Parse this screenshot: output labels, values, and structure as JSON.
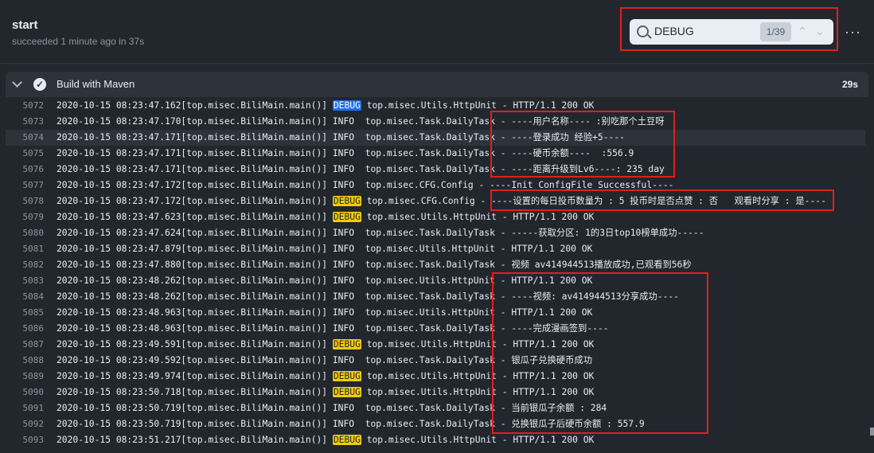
{
  "job": {
    "title": "start",
    "subtitle": "succeeded 1 minute ago in 37s"
  },
  "search": {
    "query": "DEBUG",
    "count": "1/39",
    "prev_icon": "chevron-up",
    "next_icon": "chevron-down"
  },
  "menu": {
    "more_label": "···"
  },
  "step": {
    "title": "Build with Maven",
    "duration": "29s",
    "status_icon": "check-circle"
  },
  "log": {
    "search_term": "DEBUG",
    "lines": [
      {
        "n": "5072",
        "ts": "2020-10-15 08:23:47.162[top.misec.BiliMain.main()]",
        "level": "DEBUG",
        "src": "top.misec.Utils.HttpUnit",
        "msg": "- HTTP/1.1 200 OK",
        "current": true
      },
      {
        "n": "5073",
        "ts": "2020-10-15 08:23:47.170[top.misec.BiliMain.main()]",
        "level": "INFO",
        "src": "top.misec.Task.DailyTask",
        "msg": "- ----用户名称---- :别吃那个土豆呀"
      },
      {
        "n": "5074",
        "ts": "2020-10-15 08:23:47.171[top.misec.BiliMain.main()]",
        "level": "INFO",
        "src": "top.misec.Task.DailyTask",
        "msg": "- ----登录成功 经验+5----",
        "active": true
      },
      {
        "n": "5075",
        "ts": "2020-10-15 08:23:47.171[top.misec.BiliMain.main()]",
        "level": "INFO",
        "src": "top.misec.Task.DailyTask",
        "msg": "- ----硬币余额----  :556.9"
      },
      {
        "n": "5076",
        "ts": "2020-10-15 08:23:47.171[top.misec.BiliMain.main()]",
        "level": "INFO",
        "src": "top.misec.Task.DailyTask",
        "msg": "- ----距离升级到Lv6----: 235 day"
      },
      {
        "n": "5077",
        "ts": "2020-10-15 08:23:47.172[top.misec.BiliMain.main()]",
        "level": "INFO",
        "src": "top.misec.CFG.Config",
        "msg": "- ----Init ConfigFile Successful----"
      },
      {
        "n": "5078",
        "ts": "2020-10-15 08:23:47.172[top.misec.BiliMain.main()]",
        "level": "DEBUG",
        "src": "top.misec.CFG.Config",
        "msg": "- ----设置的每日投币数量为 : 5 投币时是否点赞 : 否   观看时分享 : 是----"
      },
      {
        "n": "5079",
        "ts": "2020-10-15 08:23:47.623[top.misec.BiliMain.main()]",
        "level": "DEBUG",
        "src": "top.misec.Utils.HttpUnit",
        "msg": "- HTTP/1.1 200 OK"
      },
      {
        "n": "5080",
        "ts": "2020-10-15 08:23:47.624[top.misec.BiliMain.main()]",
        "level": "INFO",
        "src": "top.misec.Task.DailyTask",
        "msg": "- -----获取分区: 1的3日top10榜单成功-----"
      },
      {
        "n": "5081",
        "ts": "2020-10-15 08:23:47.879[top.misec.BiliMain.main()]",
        "level": "INFO",
        "src": "top.misec.Utils.HttpUnit",
        "msg": "- HTTP/1.1 200 OK"
      },
      {
        "n": "5082",
        "ts": "2020-10-15 08:23:47.880[top.misec.BiliMain.main()]",
        "level": "INFO",
        "src": "top.misec.Task.DailyTask",
        "msg": "- 视频 av414944513播放成功,已观看到56秒"
      },
      {
        "n": "5083",
        "ts": "2020-10-15 08:23:48.262[top.misec.BiliMain.main()]",
        "level": "INFO",
        "src": "top.misec.Utils.HttpUnit",
        "msg": "- HTTP/1.1 200 OK"
      },
      {
        "n": "5084",
        "ts": "2020-10-15 08:23:48.262[top.misec.BiliMain.main()]",
        "level": "INFO",
        "src": "top.misec.Task.DailyTask",
        "msg": "- ----视频: av414944513分享成功----"
      },
      {
        "n": "5085",
        "ts": "2020-10-15 08:23:48.963[top.misec.BiliMain.main()]",
        "level": "INFO",
        "src": "top.misec.Utils.HttpUnit",
        "msg": "- HTTP/1.1 200 OK"
      },
      {
        "n": "5086",
        "ts": "2020-10-15 08:23:48.963[top.misec.BiliMain.main()]",
        "level": "INFO",
        "src": "top.misec.Task.DailyTask",
        "msg": "- ----完成漫画签到----"
      },
      {
        "n": "5087",
        "ts": "2020-10-15 08:23:49.591[top.misec.BiliMain.main()]",
        "level": "DEBUG",
        "src": "top.misec.Utils.HttpUnit",
        "msg": "- HTTP/1.1 200 OK"
      },
      {
        "n": "5088",
        "ts": "2020-10-15 08:23:49.592[top.misec.BiliMain.main()]",
        "level": "INFO",
        "src": "top.misec.Task.DailyTask",
        "msg": "- 银瓜子兑换硬币成功"
      },
      {
        "n": "5089",
        "ts": "2020-10-15 08:23:49.974[top.misec.BiliMain.main()]",
        "level": "DEBUG",
        "src": "top.misec.Utils.HttpUnit",
        "msg": "- HTTP/1.1 200 OK"
      },
      {
        "n": "5090",
        "ts": "2020-10-15 08:23:50.718[top.misec.BiliMain.main()]",
        "level": "DEBUG",
        "src": "top.misec.Utils.HttpUnit",
        "msg": "- HTTP/1.1 200 OK"
      },
      {
        "n": "5091",
        "ts": "2020-10-15 08:23:50.719[top.misec.BiliMain.main()]",
        "level": "INFO",
        "src": "top.misec.Task.DailyTask",
        "msg": "- 当前银瓜子余额 : 284"
      },
      {
        "n": "5092",
        "ts": "2020-10-15 08:23:50.719[top.misec.BiliMain.main()]",
        "level": "INFO",
        "src": "top.misec.Task.DailyTask",
        "msg": "- 兑换银瓜子后硬币余额 : 557.9"
      },
      {
        "n": "5093",
        "ts": "2020-10-15 08:23:51.217[top.misec.BiliMain.main()]",
        "level": "DEBUG",
        "src": "top.misec.Utils.HttpUnit",
        "msg": "- HTTP/1.1 200 OK"
      }
    ]
  },
  "colors": {
    "highlight_border": "#e0201a",
    "current_match": "#1f6feb",
    "match": "#f2cc0c",
    "background": "#22272e"
  }
}
